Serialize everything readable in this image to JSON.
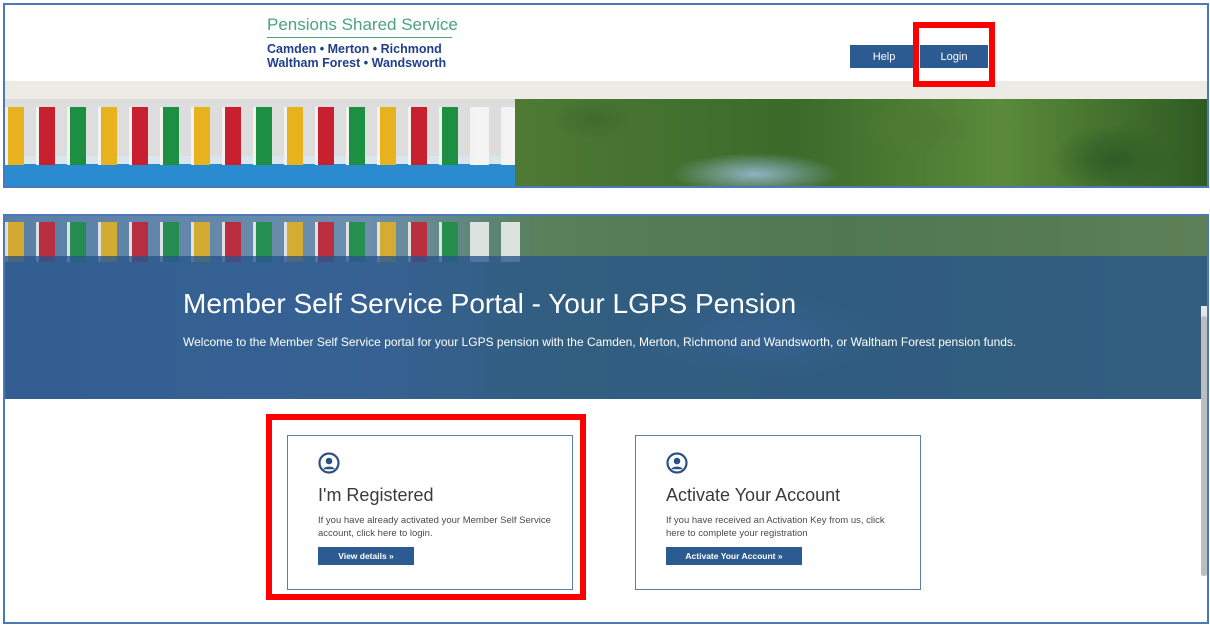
{
  "header": {
    "logo": {
      "title": "Pensions Shared Service",
      "line1": "Camden • Merton • Richmond",
      "line2": "Waltham Forest • Wandsworth"
    },
    "nav": {
      "help_label": "Help",
      "login_label": "Login"
    }
  },
  "hero": {
    "title": "Member Self Service Portal - Your LGPS Pension",
    "text": "Welcome to the Member Self Service portal for your LGPS pension with the Camden, Merton, Richmond and Wandsworth, or Waltham Forest pension funds."
  },
  "cards": [
    {
      "icon": "user-circle-icon",
      "title": "I'm Registered",
      "text": "If you have already activated your Member Self Service account, click here to login.",
      "button_label": "View details »"
    },
    {
      "icon": "user-circle-icon",
      "title": "Activate Your Account",
      "text": "If you have received an Activation Key from us, click here to complete your registration",
      "button_label": "Activate Your Account »"
    }
  ],
  "colors": {
    "brand_blue": "#2c5b92",
    "logo_green": "#4aa37a",
    "logo_navy": "#1f3f8a",
    "highlight_red": "#ff0000"
  }
}
